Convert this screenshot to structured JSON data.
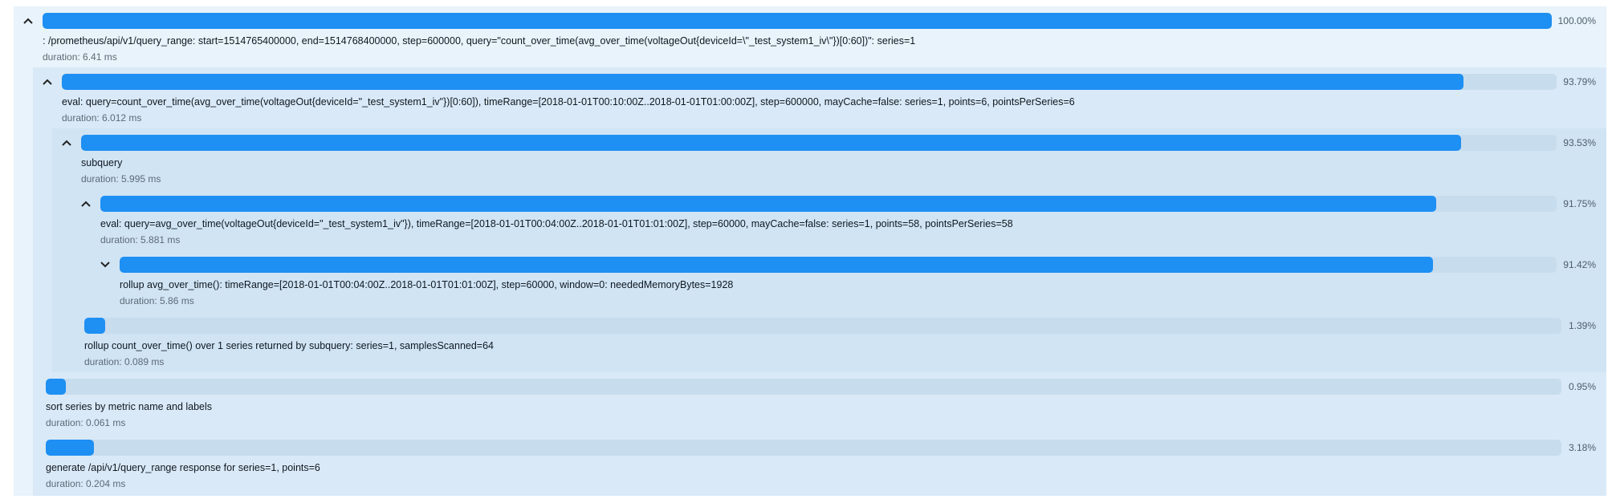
{
  "colors": {
    "bar_fill": "#1e8ff3",
    "bar_track": "#c7dced",
    "level0_bg": "#e8f3fb",
    "level1_bg": "#d9e9f7",
    "level2_bg": "#d0e4f4"
  },
  "icons": {
    "expanded": "chevron-up-icon",
    "collapsed": "chevron-down-icon"
  },
  "trace": [
    {
      "percent_value": 100.0,
      "percent_label": "100.00%",
      "message": ": /prometheus/api/v1/query_range: start=1514765400000, end=1514768400000, step=600000, query=\"count_over_time(avg_over_time(voltageOut{deviceId=\\\"_test_system1_iv\\\"})[0:60])\": series=1",
      "duration": "duration: 6.41 ms",
      "toggle": "expanded"
    },
    {
      "percent_value": 93.79,
      "percent_label": "93.79%",
      "message": "eval: query=count_over_time(avg_over_time(voltageOut{deviceId=\"_test_system1_iv\"})[0:60]), timeRange=[2018-01-01T00:10:00Z..2018-01-01T01:00:00Z], step=600000, mayCache=false: series=1, points=6, pointsPerSeries=6",
      "duration": "duration: 6.012 ms",
      "toggle": "expanded"
    },
    {
      "percent_value": 93.53,
      "percent_label": "93.53%",
      "message": "subquery",
      "duration": "duration: 5.995 ms",
      "toggle": "expanded"
    },
    {
      "percent_value": 91.75,
      "percent_label": "91.75%",
      "message": "eval: query=avg_over_time(voltageOut{deviceId=\"_test_system1_iv\"}), timeRange=[2018-01-01T00:04:00Z..2018-01-01T01:01:00Z], step=60000, mayCache=false: series=1, points=58, pointsPerSeries=58",
      "duration": "duration: 5.881 ms",
      "toggle": "expanded"
    },
    {
      "percent_value": 91.42,
      "percent_label": "91.42%",
      "message": "rollup avg_over_time(): timeRange=[2018-01-01T00:04:00Z..2018-01-01T01:01:00Z], step=60000, window=0: neededMemoryBytes=1928",
      "duration": "duration: 5.86 ms",
      "toggle": "collapsed"
    },
    {
      "percent_value": 1.39,
      "percent_label": "1.39%",
      "message": "rollup count_over_time() over 1 series returned by subquery: series=1, samplesScanned=64",
      "duration": "duration: 0.089 ms",
      "toggle": null
    },
    {
      "percent_value": 0.95,
      "percent_label": "0.95%",
      "message": "sort series by metric name and labels",
      "duration": "duration: 0.061 ms",
      "toggle": null
    },
    {
      "percent_value": 3.18,
      "percent_label": "3.18%",
      "message": "generate /api/v1/query_range response for series=1, points=6",
      "duration": "duration: 0.204 ms",
      "toggle": null
    }
  ]
}
